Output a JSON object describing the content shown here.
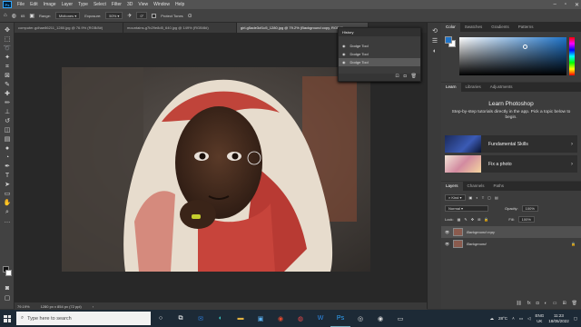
{
  "menubar": {
    "logo": "Ps",
    "items": [
      "File",
      "Edit",
      "Image",
      "Layer",
      "Type",
      "Select",
      "Filter",
      "3D",
      "View",
      "Window",
      "Help"
    ]
  },
  "options": {
    "brush_size": "65",
    "range_label": "Range:",
    "range_value": "Midtones",
    "exposure_label": "Exposure:",
    "exposure_value": "50%",
    "angle_value": "0°",
    "protect_label": "Protect Tones"
  },
  "tabs": [
    "computer-gdhae86211_1280.jpg @ 76.9% (RGB/8#)",
    "mountains-g7b29e8d5_640.jpg @ 149% (RGB/8#)",
    "girl-g5ade3cf1c5_1280.jpg @ 79.2% (Background copy, RGB/8)"
  ],
  "status": {
    "zoom": "79.19%",
    "dimensions": "1280 px x 854 px (72 ppi)"
  },
  "history": {
    "title": "History",
    "items": [
      "Dodge Tool",
      "Dodge Tool",
      "Dodge Tool"
    ]
  },
  "color_panel": {
    "tabs": [
      "Color",
      "Swatches",
      "Gradients",
      "Patterns"
    ]
  },
  "learn_panel": {
    "tabs": [
      "Learn",
      "Libraries",
      "Adjustments"
    ],
    "title": "Learn Photoshop",
    "description": "Step-by-step tutorials directly in the app. Pick a topic below to begin.",
    "cards": [
      "Fundamental Skills",
      "Fix a photo"
    ]
  },
  "layers_panel": {
    "tabs": [
      "Layers",
      "Channels",
      "Paths"
    ],
    "kind_filter": "Kind",
    "blend_mode": "Normal",
    "opacity_label": "Opacity:",
    "opacity_value": "100%",
    "lock_label": "Lock:",
    "fill_label": "Fill:",
    "fill_value": "100%",
    "layers": [
      "Background copy",
      "Background"
    ]
  },
  "taskbar": {
    "search_placeholder": "Type here to search",
    "temperature": "28°C",
    "language_1": "ENG",
    "language_2": "UK",
    "time": "11:23",
    "date": "18/05/2022"
  }
}
